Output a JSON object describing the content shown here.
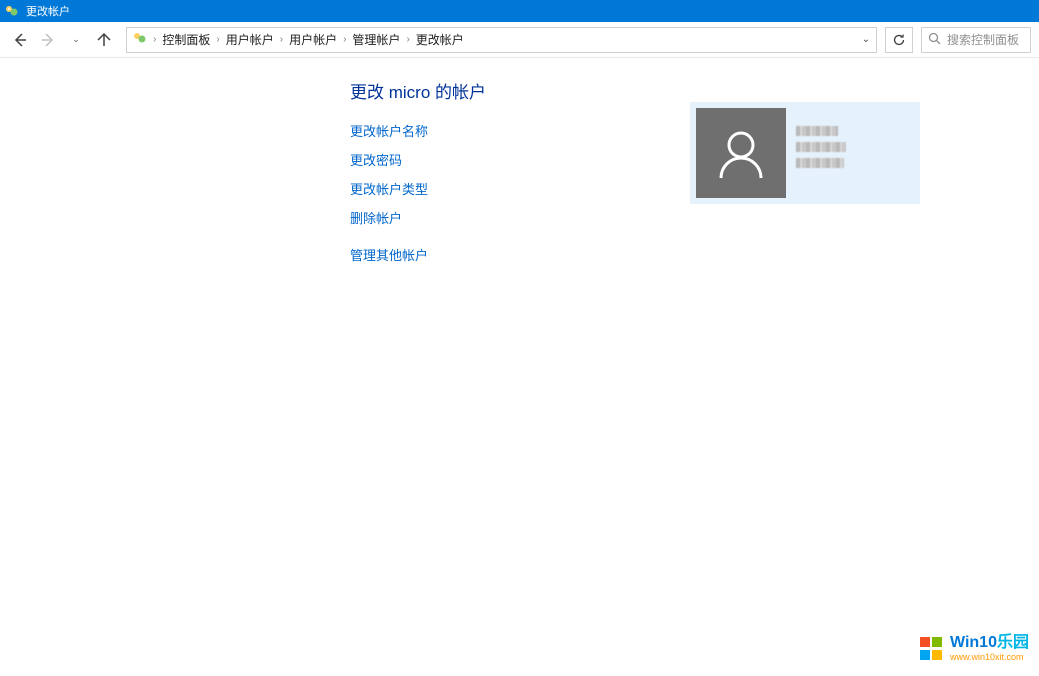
{
  "window": {
    "title": "更改帐户"
  },
  "breadcrumbs": {
    "items": [
      "控制面板",
      "用户帐户",
      "用户帐户",
      "管理帐户",
      "更改帐户"
    ]
  },
  "search": {
    "placeholder": "搜索控制面板"
  },
  "heading": "更改 micro 的帐户",
  "actions": {
    "rename": "更改帐户名称",
    "change_password": "更改密码",
    "change_type": "更改帐户类型",
    "delete": "删除帐户",
    "manage_others": "管理其他帐户"
  },
  "icons": {
    "back": "←",
    "forward": "→",
    "up": "↑",
    "refresh": "⟳",
    "search": "🔍",
    "sep": "›",
    "dropdown": "⌄"
  },
  "watermark": {
    "main_a": "Win10",
    "main_b": "乐园",
    "sub": "www.win10xit.com"
  }
}
